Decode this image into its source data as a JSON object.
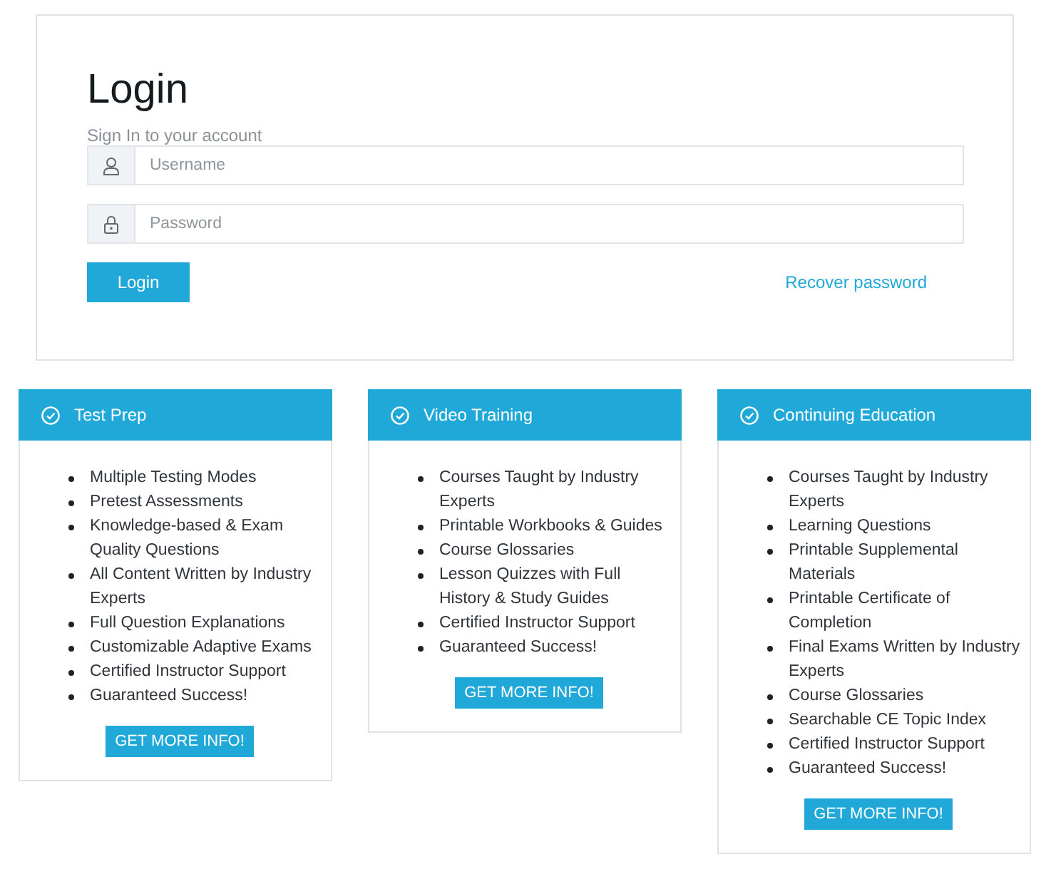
{
  "login": {
    "title": "Login",
    "subtitle": "Sign In to your account",
    "fields": [
      {
        "kind": "user",
        "placeholder": "Username"
      },
      {
        "kind": "lock",
        "placeholder": "Password"
      }
    ],
    "button": "Login",
    "recover_link": "Recover password"
  },
  "cards": [
    {
      "title": "Test Prep",
      "items": [
        "Multiple Testing Modes",
        "Pretest Assessments",
        "Knowledge-based & Exam Quality Questions",
        "All Content Written by Industry Experts",
        "Full Question Explanations",
        "Customizable Adaptive Exams",
        "Certified Instructor Support",
        "Guaranteed Success!"
      ],
      "button": "GET MORE INFO!"
    },
    {
      "title": "Video Training",
      "items": [
        "Courses Taught by Industry Experts",
        "Printable Workbooks & Guides",
        "Course Glossaries",
        "Lesson Quizzes with Full History & Study Guides",
        "Certified Instructor Support",
        "Guaranteed Success!"
      ],
      "button": "GET MORE INFO!"
    },
    {
      "title": "Continuing Education",
      "items": [
        "Courses Taught by Industry Experts",
        "Learning Questions",
        "Printable Supplemental Materials",
        "Printable Certificate of Completion",
        "Final Exams Written by Industry Experts",
        "Course Glossaries",
        "Searchable CE Topic Index",
        "Certified Instructor Support",
        "Guaranteed Success!"
      ],
      "button": "GET MORE INFO!"
    }
  ]
}
